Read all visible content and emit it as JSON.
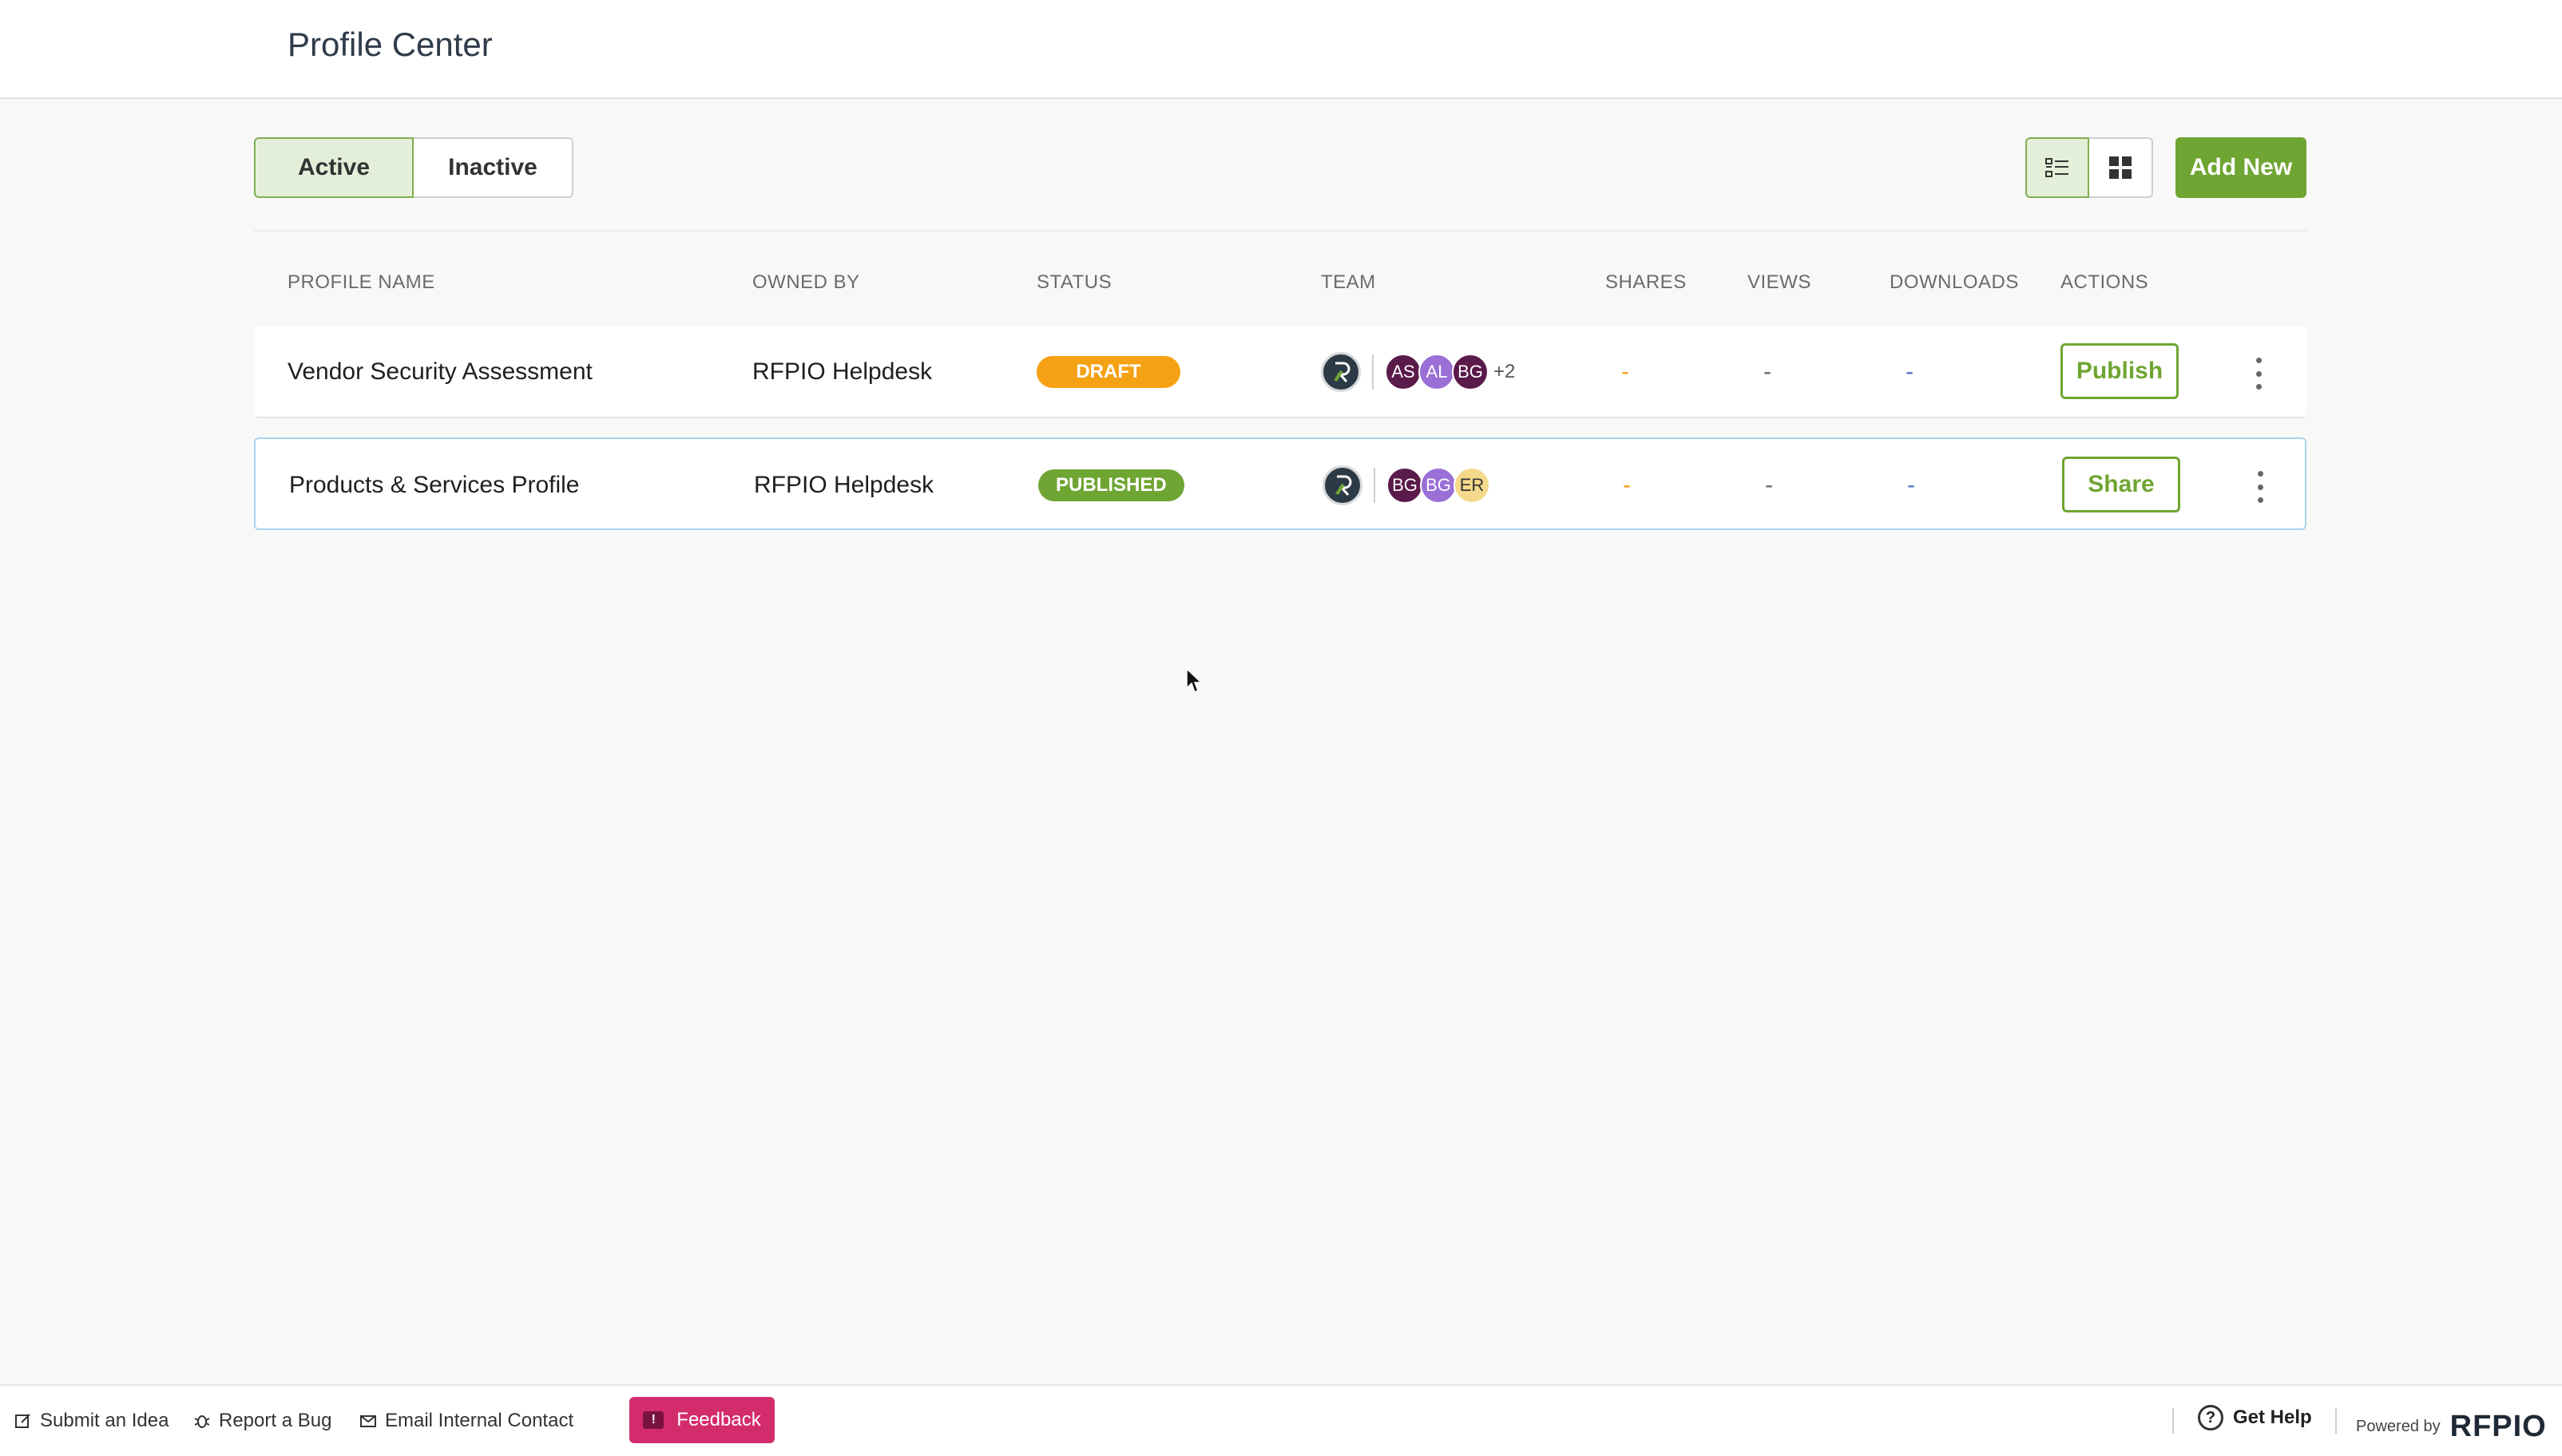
{
  "header": {
    "title": "Profile Center"
  },
  "tabs": {
    "active": "Active",
    "inactive": "Inactive"
  },
  "toolbar": {
    "add_new": "Add New",
    "list_view_icon": "list-view-icon",
    "grid_view_icon": "grid-view-icon"
  },
  "columns": {
    "profile_name": "PROFILE NAME",
    "owned_by": "OWNED BY",
    "status": "STATUS",
    "team": "TEAM",
    "shares": "SHARES",
    "views": "VIEWS",
    "downloads": "DOWNLOADS",
    "actions": "ACTIONS"
  },
  "rows": [
    {
      "name": "Vendor Security Assessment",
      "owner": "RFPIO Helpdesk",
      "status": "DRAFT",
      "team": [
        "AS",
        "AL",
        "BG"
      ],
      "team_more": "+2",
      "shares": "-",
      "views": "-",
      "downloads": "-",
      "action": "Publish"
    },
    {
      "name": "Products & Services Profile",
      "owner": "RFPIO Helpdesk",
      "status": "PUBLISHED",
      "team": [
        "BG",
        "BG",
        "ER"
      ],
      "shares": "-",
      "views": "-",
      "downloads": "-",
      "action": "Share"
    }
  ],
  "footer": {
    "submit_idea": "Submit an Idea",
    "report_bug": "Report a Bug",
    "email_contact": "Email Internal Contact",
    "feedback": "Feedback",
    "get_help": "Get Help",
    "powered_by": "Powered by",
    "brand": "RFPIO"
  },
  "colors": {
    "accent_green": "#6fa532",
    "draft_orange": "#f5a114",
    "feedback_pink": "#d32c6c"
  }
}
